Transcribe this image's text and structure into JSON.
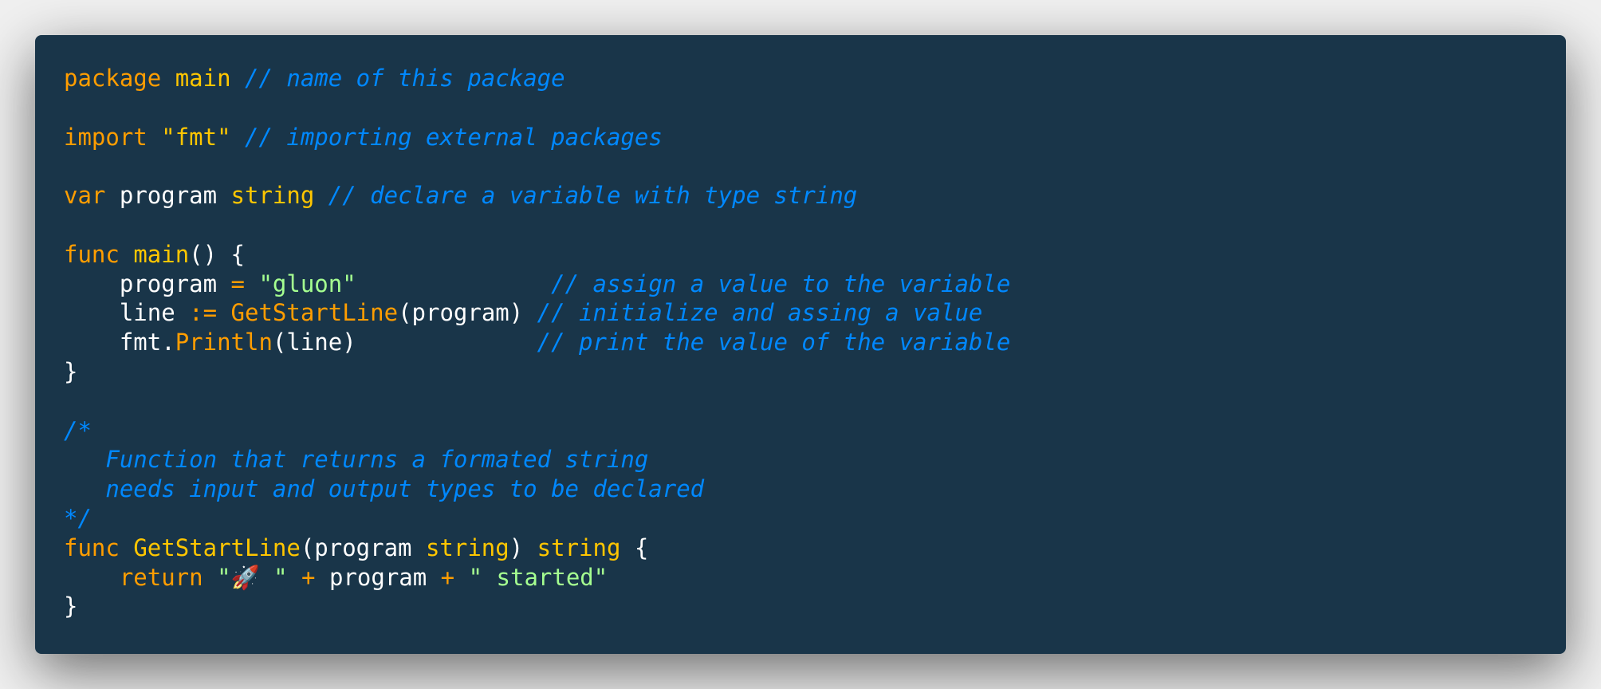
{
  "code": {
    "l1": {
      "kw": "package",
      "name": "main",
      "comment": "// name of this package"
    },
    "l2": {
      "kw": "import",
      "str": "\"fmt\"",
      "comment": "// importing external packages"
    },
    "l3": {
      "kw": "var",
      "ident": "program",
      "type": "string",
      "comment": "// declare a variable with type string"
    },
    "l4": {
      "kw": "func",
      "fn": "main",
      "rest": "() {"
    },
    "l5": {
      "indent": "    ",
      "ident": "program",
      "op": "=",
      "str": "\"gluon\"",
      "pad": "              ",
      "comment": "// assign a value to the variable"
    },
    "l6": {
      "indent": "    ",
      "ident": "line",
      "op": ":=",
      "fn": "GetStartLine",
      "args": "(program)",
      "comment": "// initialize and assing a value"
    },
    "l7": {
      "indent": "    ",
      "pkg": "fmt.",
      "fn": "Println",
      "args": "(line)",
      "pad": "             ",
      "comment": "// print the value of the variable"
    },
    "l8": {
      "text": "}"
    },
    "l9": {
      "c1": "/*",
      "c2": "   Function that returns a formated string",
      "c3": "   needs input and output types to be declared",
      "c4": "*/"
    },
    "l10": {
      "kw": "func",
      "fn": "GetStartLine",
      "params_open": "(program ",
      "ptype": "string",
      "params_close": ") ",
      "rtype": "string",
      "brace": " {"
    },
    "l11": {
      "indent": "    ",
      "kw": "return",
      "str1": "\"🚀 \"",
      "op1": "+",
      "ident": "program",
      "op2": "+",
      "str2": "\" started\""
    },
    "l12": {
      "text": "}"
    }
  },
  "colors": {
    "background": "#193549",
    "keyword": "#ff9d00",
    "function": "#ffc600",
    "string": "#a5ff90",
    "comment": "#0088ff",
    "plain": "#ffffff"
  }
}
